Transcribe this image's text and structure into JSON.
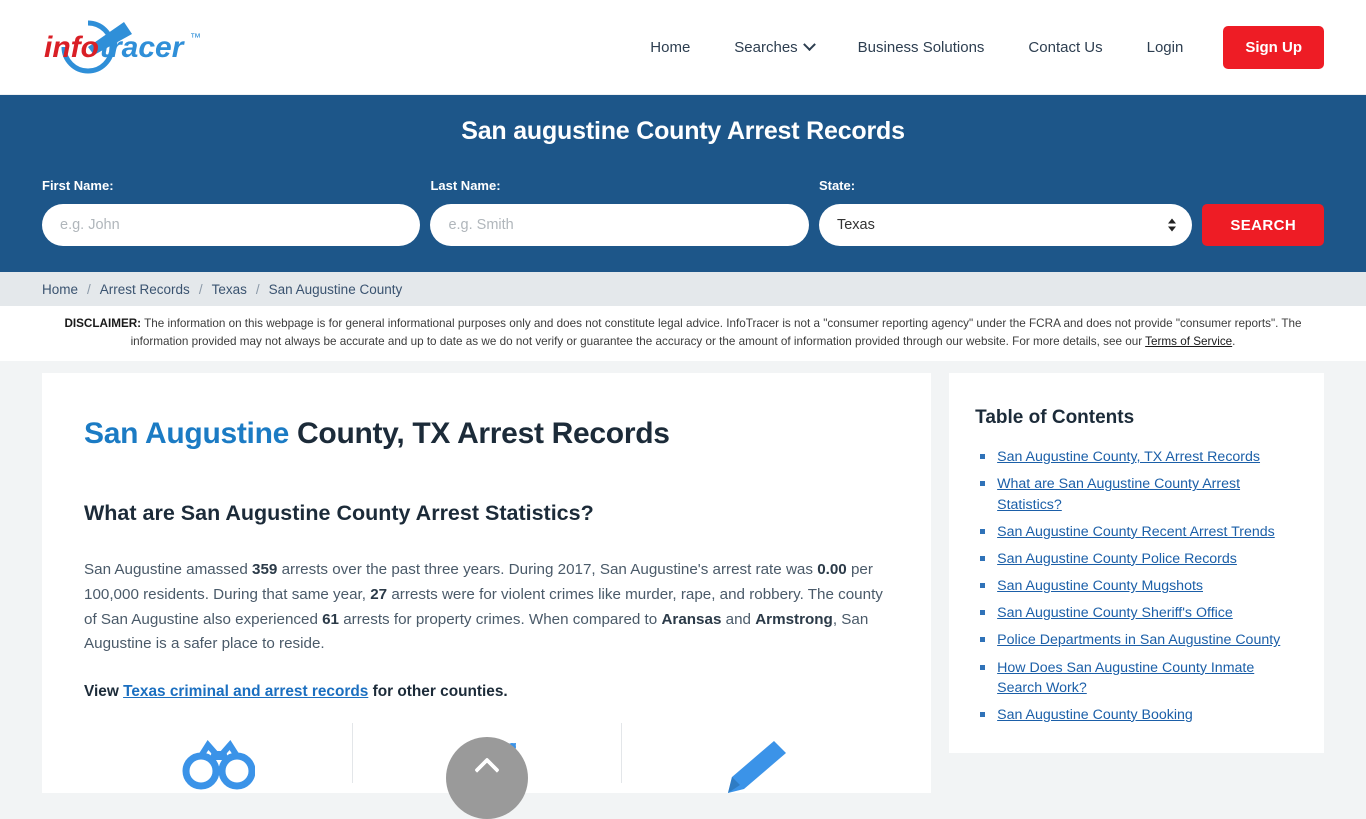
{
  "brand": {
    "name_part1": "info",
    "name_part2": "tracer",
    "trademark": "™",
    "red": "#d91f26",
    "blue": "#2f8fd8"
  },
  "nav": {
    "items": [
      {
        "label": "Home",
        "has_caret": false
      },
      {
        "label": "Searches",
        "has_caret": true
      },
      {
        "label": "Business Solutions",
        "has_caret": false
      },
      {
        "label": "Contact Us",
        "has_caret": false
      },
      {
        "label": "Login",
        "has_caret": false
      }
    ],
    "signup_label": "Sign Up"
  },
  "hero": {
    "title": "San augustine County Arrest Records",
    "first_name_label": "First Name:",
    "first_name_placeholder": "e.g. John",
    "first_name_value": "",
    "last_name_label": "Last Name:",
    "last_name_placeholder": "e.g. Smith",
    "last_name_value": "",
    "state_label": "State:",
    "state_value": "Texas",
    "state_options": [
      "Texas"
    ],
    "search_label": "SEARCH",
    "background": "#1d5689",
    "accent_red": "#ee1c25"
  },
  "breadcrumb": {
    "items": [
      "Home",
      "Arrest Records",
      "Texas",
      "San Augustine County"
    ],
    "separator": "/"
  },
  "disclaimer": {
    "label": "DISCLAIMER:",
    "text": " The information on this webpage is for general informational purposes only and does not constitute legal advice. InfoTracer is not a \"consumer reporting agency\" under the FCRA and does not provide \"consumer reports\". The information provided may not always be accurate and up to date as we do not verify or guarantee the accuracy or the amount of information provided through our website. For more details, see our ",
    "link_text": "Terms of Service",
    "period": "."
  },
  "main": {
    "title_highlight": "San Augustine",
    "title_rest": " County, TX Arrest Records",
    "subtitle": "What are San Augustine County Arrest Statistics?",
    "paragraph": {
      "p1": "San Augustine amassed ",
      "b1": "359",
      "p2": " arrests over the past three years. During 2017, San Augustine's arrest rate was ",
      "b2": "0.00",
      "p3": " per 100,000 residents. During that same year, ",
      "b3": "27",
      "p4": " arrests were for violent crimes like murder, rape, and robbery. The county of San Augustine also experienced ",
      "b4": "61",
      "p5": " arrests for property crimes. When compared to ",
      "b5": "Aransas",
      "p6": " and ",
      "b6": "Armstrong",
      "p7": ", San Augustine is a safer place to reside."
    },
    "view_prefix": "View ",
    "view_link": "Texas criminal and arrest records",
    "view_suffix": " for other counties.",
    "stat_icons": [
      "handcuffs-icon",
      "trend-arrow-icon",
      "pen-icon"
    ]
  },
  "toc": {
    "title": "Table of Contents",
    "items": [
      "San Augustine County, TX Arrest Records",
      "What are San Augustine County Arrest Statistics?",
      "San Augustine County Recent Arrest Trends",
      "San Augustine County Police Records",
      "San Augustine County Mugshots",
      "San Augustine County Sheriff's Office",
      "Police Departments in San Augustine County",
      "How Does San Augustine County Inmate Search Work?",
      "San Augustine County Booking"
    ]
  },
  "scroll_top": {
    "name": "scroll-to-top-button"
  }
}
